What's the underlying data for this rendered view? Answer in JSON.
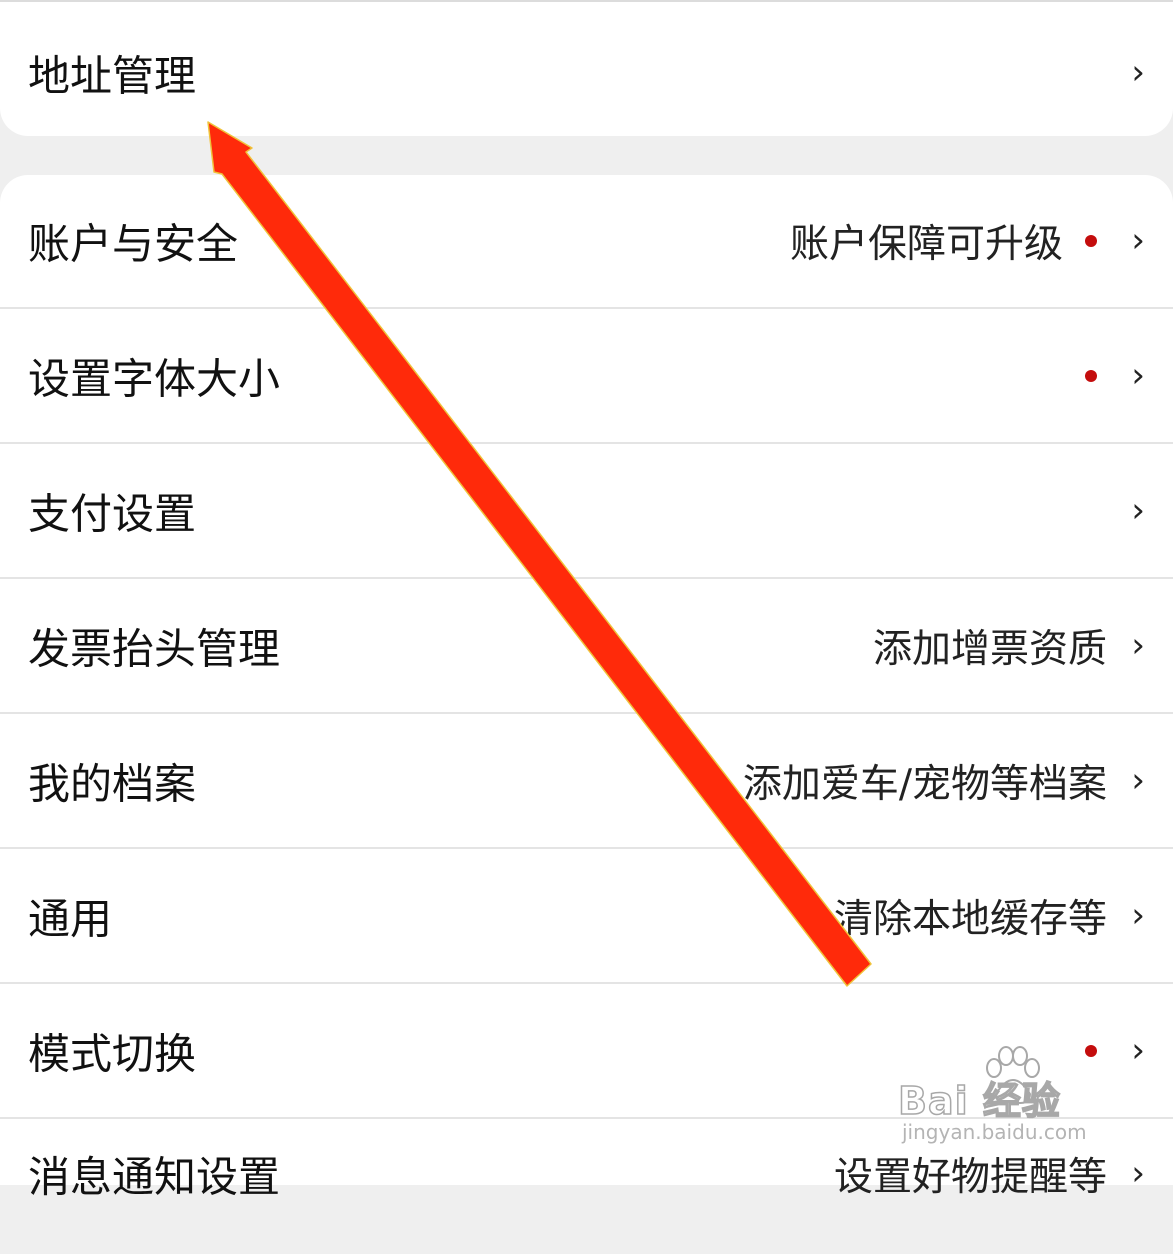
{
  "top_section": {
    "items": [
      {
        "label": "地址管理",
        "chevron": "›"
      }
    ]
  },
  "settings": {
    "items": [
      {
        "label": "账户与安全",
        "value": "账户保障可升级",
        "has_red_dot": true,
        "chevron": "›"
      },
      {
        "label": "设置字体大小",
        "value": "",
        "has_red_dot": true,
        "chevron": "›"
      },
      {
        "label": "支付设置",
        "value": "",
        "has_red_dot": false,
        "chevron": "›"
      },
      {
        "label": "发票抬头管理",
        "value": "添加增票资质",
        "has_red_dot": false,
        "chevron": "›"
      },
      {
        "label": "我的档案",
        "value": "添加爱车/宠物等档案",
        "has_red_dot": false,
        "chevron": "›"
      },
      {
        "label": "通用",
        "value": "清除本地缓存等",
        "has_red_dot": false,
        "chevron": "›"
      },
      {
        "label": "模式切换",
        "value": "",
        "has_red_dot": true,
        "chevron": "›"
      },
      {
        "label": "消息通知设置",
        "value": "设置好物提醒等",
        "has_red_dot": false,
        "chevron": "›"
      }
    ]
  },
  "watermark": {
    "brand": "Bai  经验",
    "site": "jingyan.baidu.com"
  },
  "colors": {
    "page_background": "#efefef",
    "card_background": "#ffffff",
    "red_dot": "#c40d0d",
    "annotation_arrow": "#ff2a0a"
  },
  "icons": {
    "chevron": "chevron-right-icon",
    "annotation": "annotation-arrow",
    "watermark_logo": "paw-icon"
  }
}
